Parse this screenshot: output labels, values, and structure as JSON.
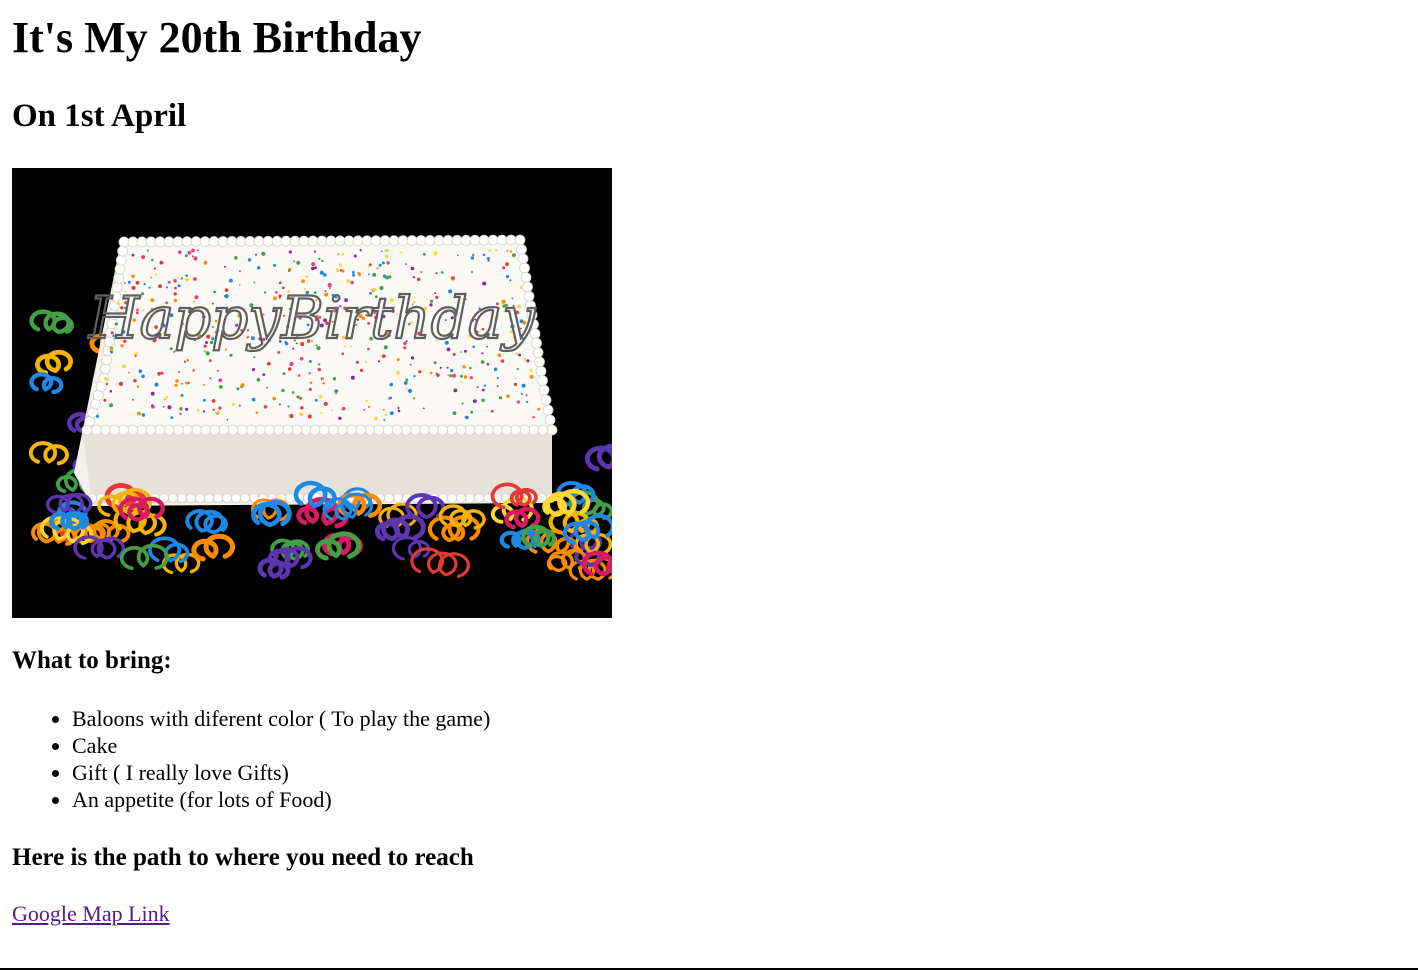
{
  "heading": "It's My 20th Birthday",
  "date": "On 1st April",
  "cake_image": {
    "cake_text": "HappyBirthday",
    "colors": {
      "background": "#000000",
      "frosting": "#f7f5f0",
      "frosting_shadow": "#dcd8d0",
      "writing": "#6b6b6b"
    },
    "sprinkle_colors": [
      "#e53935",
      "#1e88e5",
      "#fdd835",
      "#43a047",
      "#fb8c00",
      "#8e24aa",
      "#ec407a"
    ],
    "ribbon_colors": [
      "#e53935",
      "#fb8c00",
      "#fdd835",
      "#43a047",
      "#1e88e5",
      "#5e35b1",
      "#d81b60",
      "#f4b400"
    ]
  },
  "bring": {
    "title": "What to bring:",
    "items": [
      "Baloons with diferent color ( To play the game)",
      "Cake",
      "Gift ( I really love Gifts)",
      "An appetite (for lots of Food)"
    ]
  },
  "path": {
    "title": "Here is the path to where you need to reach",
    "link_text": "Google Map Link",
    "link_color": "#551a8b"
  }
}
